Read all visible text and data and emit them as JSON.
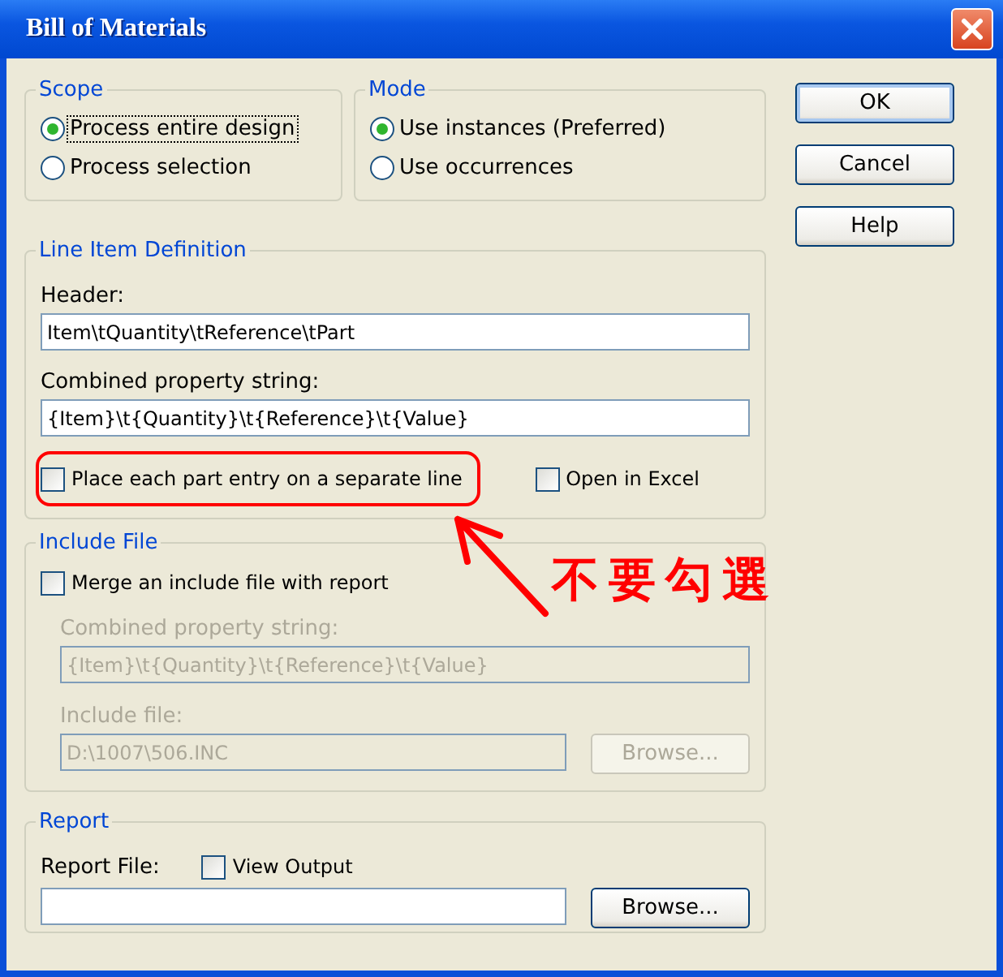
{
  "window": {
    "title": "Bill of Materials"
  },
  "scope": {
    "title": "Scope",
    "options": [
      {
        "label": "Process entire design",
        "selected": true,
        "focused": true
      },
      {
        "label": "Process selection",
        "selected": false,
        "focused": false
      }
    ]
  },
  "mode": {
    "title": "Mode",
    "options": [
      {
        "label": "Use instances (Preferred)",
        "selected": true,
        "focused": false
      },
      {
        "label": "Use occurrences",
        "selected": false,
        "focused": false
      }
    ]
  },
  "line_item": {
    "title": "Line Item Definition",
    "header": {
      "label": "Header:",
      "value": "Item\\tQuantity\\tReference\\tPart"
    },
    "combined": {
      "label": "Combined property string:",
      "value": "{Item}\\t{Quantity}\\t{Reference}\\t{Value}"
    },
    "checkboxes": [
      {
        "label": "Place each part entry on a separate line",
        "checked": false
      },
      {
        "label": "Open in Excel",
        "checked": false
      }
    ]
  },
  "include_file": {
    "title": "Include File",
    "merge": {
      "label": "Merge an include file with report",
      "checked": false
    },
    "combined": {
      "label": "Combined property string:",
      "value": "{Item}\\t{Quantity}\\t{Reference}\\t{Value}",
      "disabled": true
    },
    "include": {
      "label": "Include file:",
      "value": "D:\\1007\\506.INC",
      "disabled": true
    },
    "browse": {
      "label": "Browse...",
      "disabled": true
    }
  },
  "report": {
    "title": "Report",
    "file_label": "Report File:",
    "view_output": {
      "label": "View Output",
      "checked": false
    },
    "browse": {
      "label": "Browse...",
      "disabled": false
    }
  },
  "buttons": [
    {
      "label": "OK",
      "default": true
    },
    {
      "label": "Cancel",
      "default": false
    },
    {
      "label": "Help",
      "default": false
    }
  ],
  "annotation": {
    "text": "不要勾選"
  }
}
